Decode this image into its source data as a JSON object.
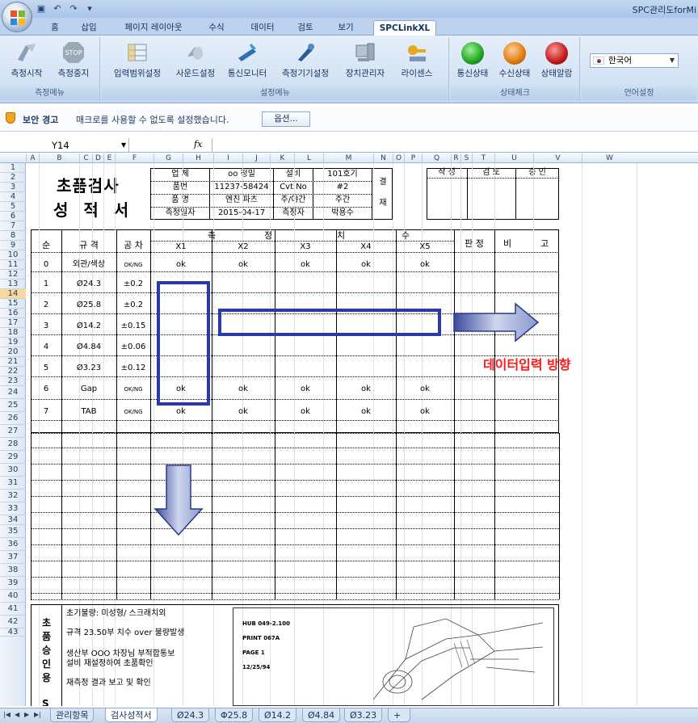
{
  "window": {
    "title": "SPC관리도forMi"
  },
  "ribbon": {
    "tabs": [
      "홈",
      "삽입",
      "페이지 레이아웃",
      "수식",
      "데이터",
      "검토",
      "보기",
      "SPCLinkXL"
    ],
    "active_tab": "SPCLinkXL",
    "groups": [
      {
        "label": "측정메뉴",
        "buttons": [
          "측정시작",
          "측정중지"
        ]
      },
      {
        "label": "설정메뉴",
        "buttons": [
          "입력범위설정",
          "사운드설정",
          "통신모니터",
          "측정기기설정",
          "장치관리자",
          "라이센스"
        ]
      },
      {
        "label": "상태체크",
        "buttons": [
          "통신상태",
          "수신상태",
          "상태알람"
        ]
      },
      {
        "label": "언어설정",
        "buttons": []
      }
    ],
    "language_value": "한국어",
    "stop_icon_text": "STOP",
    "light_colors": [
      "#1fa31f",
      "#e07a10",
      "#c21818"
    ]
  },
  "security": {
    "title": "보안 경고",
    "message": "매크로를 사용할 수 없도록 설정했습니다.",
    "button": "옵션..."
  },
  "formula_bar": {
    "name_box": "Y14",
    "fx": "fx",
    "formula": ""
  },
  "columns": [
    "A",
    "B",
    "C",
    "D",
    "E",
    "F",
    "G",
    "H",
    "I",
    "J",
    "K",
    "L",
    "M",
    "N",
    "O",
    "P",
    "Q",
    "R",
    "S",
    "T",
    "U",
    "V",
    "W"
  ],
  "rows": [
    "1",
    "2",
    "3",
    "4",
    "5",
    "6",
    "7",
    "8",
    "9",
    "10",
    "11",
    "12",
    "13",
    "14",
    "15",
    "16",
    "17",
    "18",
    "19",
    "20",
    "21",
    "22",
    "23",
    "24",
    "25",
    "26",
    "27",
    "28",
    "29",
    "30",
    "31",
    "32",
    "33",
    "34",
    "35",
    "36",
    "37",
    "38",
    "39",
    "40",
    "41",
    "42",
    "43"
  ],
  "selected_row": "14",
  "sheet": {
    "title1": "초품검사",
    "title2": "성 적 서",
    "info_labels": [
      "업 체",
      "품번",
      "품 명",
      "측정일자"
    ],
    "info_values": [
      "oo 정밀",
      "11237-58424",
      "엔진 파츠",
      "2015-04-17"
    ],
    "info_labels2": [
      "설비",
      "Cvt No",
      "주/야간",
      "측정자"
    ],
    "info_values2": [
      "101호기",
      "#2",
      "주간",
      "박용수"
    ],
    "approval_label1": "결",
    "approval_label2": "재",
    "approval_cols": [
      "작 성",
      "검 토",
      "승 인"
    ],
    "header": {
      "no": "순",
      "spec": "규 격",
      "tol": "공 차",
      "measure": [
        "측",
        "정",
        "치",
        "수"
      ],
      "x": [
        "X1",
        "X2",
        "X3",
        "X4",
        "X5"
      ],
      "judge": "판 정",
      "remark": [
        "비",
        "고"
      ]
    },
    "items": [
      {
        "no": "0",
        "spec": "외관/색상",
        "tol": "OK/NG",
        "vals": [
          "ok",
          "ok",
          "ok",
          "ok",
          "ok"
        ]
      },
      {
        "no": "1",
        "spec": "Ø24.3",
        "tol": "±0.2",
        "vals": [
          "",
          "",
          "",
          "",
          ""
        ]
      },
      {
        "no": "2",
        "spec": "Ø25.8",
        "tol": "±0.2",
        "vals": [
          "",
          "",
          "",
          "",
          ""
        ]
      },
      {
        "no": "3",
        "spec": "Ø14.2",
        "tol": "±0.15",
        "vals": [
          "",
          "",
          "",
          "",
          ""
        ]
      },
      {
        "no": "4",
        "spec": "Ø4.84",
        "tol": "±0.06",
        "vals": [
          "",
          "",
          "",
          "",
          ""
        ]
      },
      {
        "no": "5",
        "spec": "Ø3.23",
        "tol": "±0.12",
        "vals": [
          "",
          "",
          "",
          "",
          ""
        ]
      },
      {
        "no": "6",
        "spec": "Gap",
        "tol": "OK/NG",
        "vals": [
          "ok",
          "ok",
          "ok",
          "ok",
          "ok"
        ]
      },
      {
        "no": "7",
        "spec": "TAB",
        "tol": "OK/NG",
        "vals": [
          "ok",
          "ok",
          "ok",
          "ok",
          "ok"
        ]
      }
    ],
    "annotation": "데이터입력 방향",
    "approval_side": [
      "초",
      "품",
      "승",
      "인",
      "용"
    ],
    "side_s": "S",
    "notes": [
      "초기불량: 미성형/ 스크래치외",
      "규격 23.50부 치수 over 불량발생",
      "생산부 OOO 차장님 부적합통보",
      "설비 재설정하여 초품확인",
      "재측정 결과 보고 및 확인"
    ],
    "drawing": [
      "HUB 049-2.100",
      "PRINT 067A",
      "PAGE 1",
      "12/25/94"
    ]
  },
  "sheet_tabs": [
    "관리항목",
    "검사성적서",
    "Ø24.3",
    "Φ25.8",
    "Ø14.2",
    "Ø4.84",
    "Ø3.23"
  ],
  "active_sheet": "검사성적서"
}
